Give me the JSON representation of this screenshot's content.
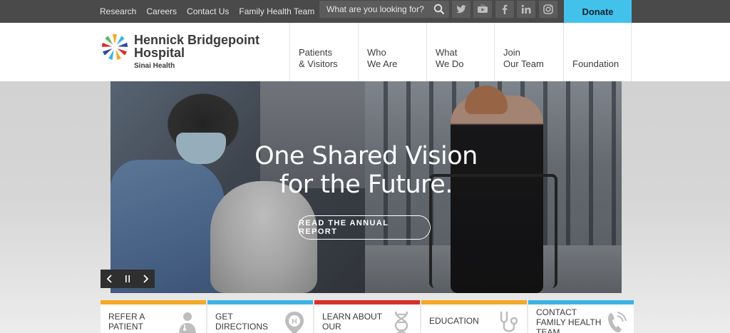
{
  "topbar": {
    "links": [
      "Research",
      "Careers",
      "Contact Us",
      "Family Health Team"
    ],
    "search_placeholder": "What are you looking for?",
    "social": [
      "twitter-icon",
      "youtube-icon",
      "facebook-icon",
      "linkedin-icon",
      "instagram-icon"
    ],
    "donate_label": "Donate",
    "donate_color": "#42c2ea"
  },
  "header": {
    "logo_name": "Hennick Bridgepoint Hospital",
    "logo_sub": "Sinai Health",
    "nav": [
      {
        "line1": "Patients",
        "line2": "& Visitors"
      },
      {
        "line1": "Who",
        "line2": "We Are"
      },
      {
        "line1": "What",
        "line2": "We Do"
      },
      {
        "line1": "Join",
        "line2": "Our Team"
      },
      {
        "line1": "",
        "line2": "Foundation"
      }
    ]
  },
  "hero": {
    "title_line1": "One Shared Vision",
    "title_line2": "for the Future.",
    "cta": "READ THE ANNUAL REPORT"
  },
  "quick_links": [
    {
      "line1": "REFER A",
      "line2": "PATIENT",
      "icon": "doctor-icon",
      "color": "#f4a928"
    },
    {
      "line1": "GET",
      "line2": "DIRECTIONS",
      "icon": "location-pin-icon",
      "color": "#3db3e3"
    },
    {
      "line1": "LEARN ABOUT",
      "line2": "OUR RESEARCH",
      "icon": "dna-icon",
      "color": "#d9302a"
    },
    {
      "line1": "EDUCATION",
      "line2": "",
      "icon": "stethoscope-icon",
      "color": "#f4a928"
    },
    {
      "line1": "CONTACT",
      "line2": "FAMILY HEALTH",
      "line3": "TEAM",
      "icon": "phone-icon",
      "color": "#3db3e3"
    }
  ]
}
